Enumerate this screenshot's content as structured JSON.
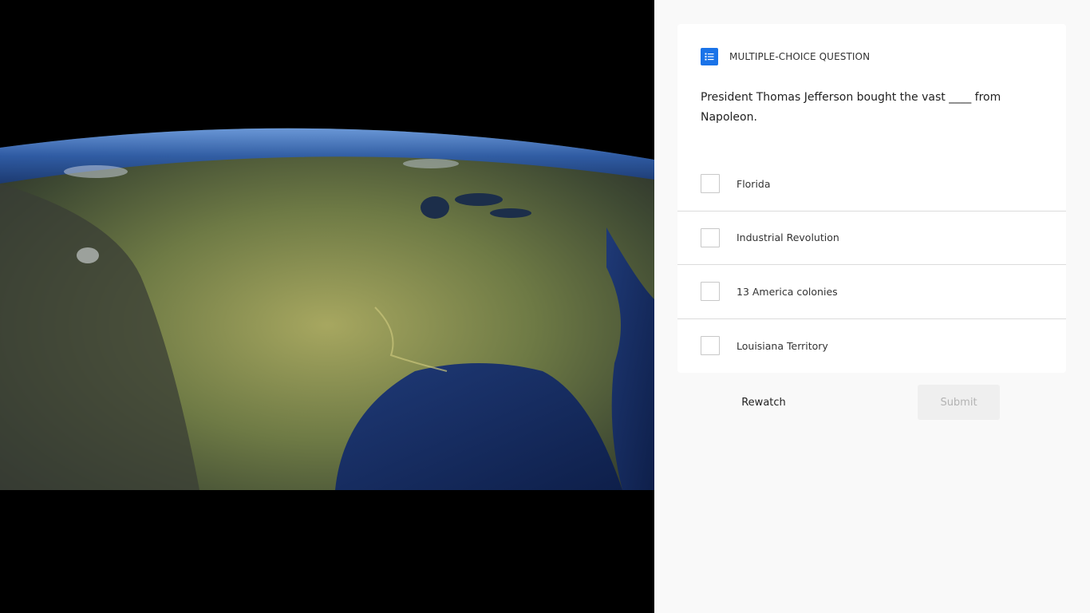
{
  "video": {
    "description_icon": "earth-from-space-image"
  },
  "question": {
    "type_icon": "list-check-icon",
    "type_label": "MULTIPLE-CHOICE QUESTION",
    "text": "President Thomas Jefferson bought the vast ____ from Napoleon.",
    "options": [
      {
        "label": "Florida",
        "checked": false
      },
      {
        "label": "Industrial Revolution",
        "checked": false
      },
      {
        "label": "13 America colonies",
        "checked": false
      },
      {
        "label": "Louisiana Territory",
        "checked": false
      }
    ]
  },
  "actions": {
    "rewatch_label": "Rewatch",
    "submit_label": "Submit",
    "submit_enabled": false
  },
  "colors": {
    "accent": "#1a73e8",
    "video_background": "#000000",
    "panel_background": "#f9f9f9"
  }
}
